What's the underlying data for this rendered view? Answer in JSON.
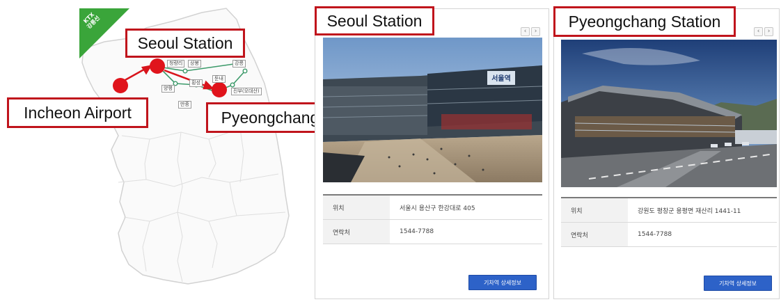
{
  "map": {
    "ribbon_text": "KTX\n강릉선",
    "callouts": {
      "seoul": "Seoul Station",
      "incheon": "Incheon Airport",
      "pyeongchang": "Pyeongchang Station"
    },
    "station_labels": [
      "청량리",
      "상봉",
      "강릉",
      "양평",
      "만종",
      "횡성",
      "둔내",
      "평창",
      "진부(오대산)"
    ]
  },
  "panels": [
    {
      "title": "Seoul Station",
      "prev_arrow": "‹",
      "next_arrow": "›",
      "rows": [
        {
          "key": "위치",
          "value": "서울시 용산구 한강대로 405"
        },
        {
          "key": "연락처",
          "value": "1544-7788"
        }
      ],
      "button": "기차역 상세정보",
      "photo_sign": "서울역"
    },
    {
      "title": "Pyeongchang Station",
      "prev_arrow": "‹",
      "next_arrow": "›",
      "rows": [
        {
          "key": "위치",
          "value": "강원도 평창군 용평면 재산리 1441-11"
        },
        {
          "key": "연락처",
          "value": "1544-7788"
        }
      ],
      "button": "기차역 상세정보"
    }
  ],
  "colors": {
    "callout_border": "#c0141c",
    "route_dot": "#e0141c",
    "ktx_line": "#3c9a6a",
    "ribbon": "#3aa53a",
    "button": "#2d62c8"
  }
}
